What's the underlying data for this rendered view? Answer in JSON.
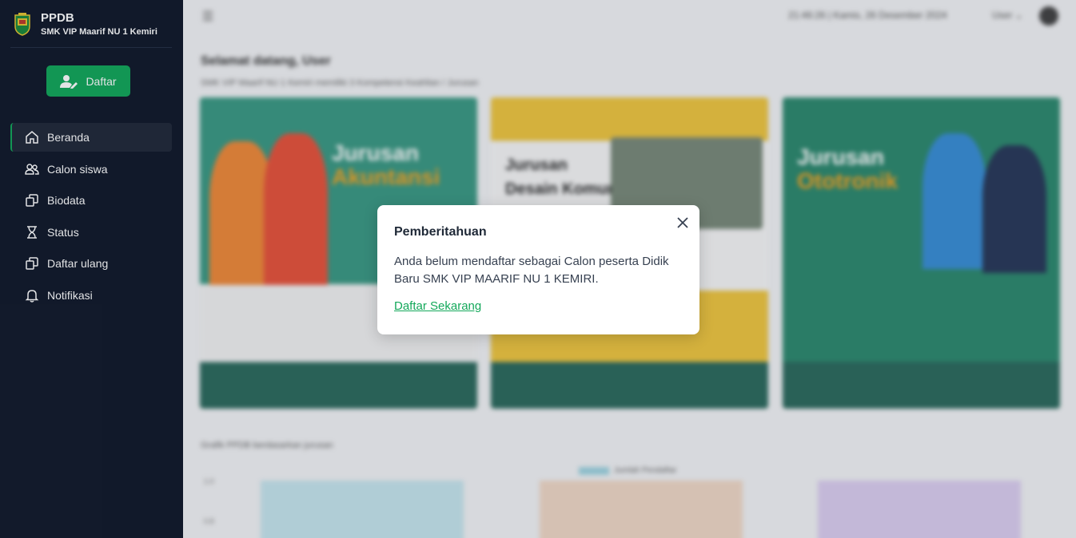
{
  "app": {
    "title": "PPDB",
    "school": "SMK VIP Maarif NU 1 Kemiri"
  },
  "colors": {
    "sidebar_bg": "#121a2b",
    "accent": "#13a85a",
    "active_bg": "#222a3a"
  },
  "sidebar": {
    "register_button": "Daftar",
    "items": [
      {
        "label": "Beranda",
        "icon": "home-icon",
        "active": true
      },
      {
        "label": "Calon siswa",
        "icon": "users-icon",
        "active": false
      },
      {
        "label": "Biodata",
        "icon": "copy-icon",
        "active": false
      },
      {
        "label": "Status",
        "icon": "hourglass-icon",
        "active": false
      },
      {
        "label": "Daftar ulang",
        "icon": "copy-icon",
        "active": false
      },
      {
        "label": "Notifikasi",
        "icon": "bell-icon",
        "active": false
      }
    ]
  },
  "header": {
    "datetime": "21:46:26 | Kamis, 26 Desember 2024",
    "user_menu": "User"
  },
  "main": {
    "welcome": "Selamat datang, User",
    "subtitle": "SMK VIP Maarif NU 1 Kemiri memiliki 3 Kompetensi Keahlian / Jurusan",
    "banners": [
      {
        "line1": "Jurusan",
        "line2": "Akuntansi"
      },
      {
        "line1": "Jurusan",
        "line2": "Desain Komunikasi"
      },
      {
        "line1": "Jurusan",
        "line2": "Ototronik"
      }
    ],
    "chart_title": "Grafik PPDB berdasarkan jurusan",
    "legend_label": "Jumlah Pendaftar",
    "ticks": [
      "1.0",
      "0.8"
    ]
  },
  "modal": {
    "title": "Pemberitahuan",
    "message": "Anda belum mendaftar sebagai Calon peserta Didik Baru SMK VIP MAARIF NU 1 KEMIRI.",
    "link": "Daftar Sekarang"
  }
}
